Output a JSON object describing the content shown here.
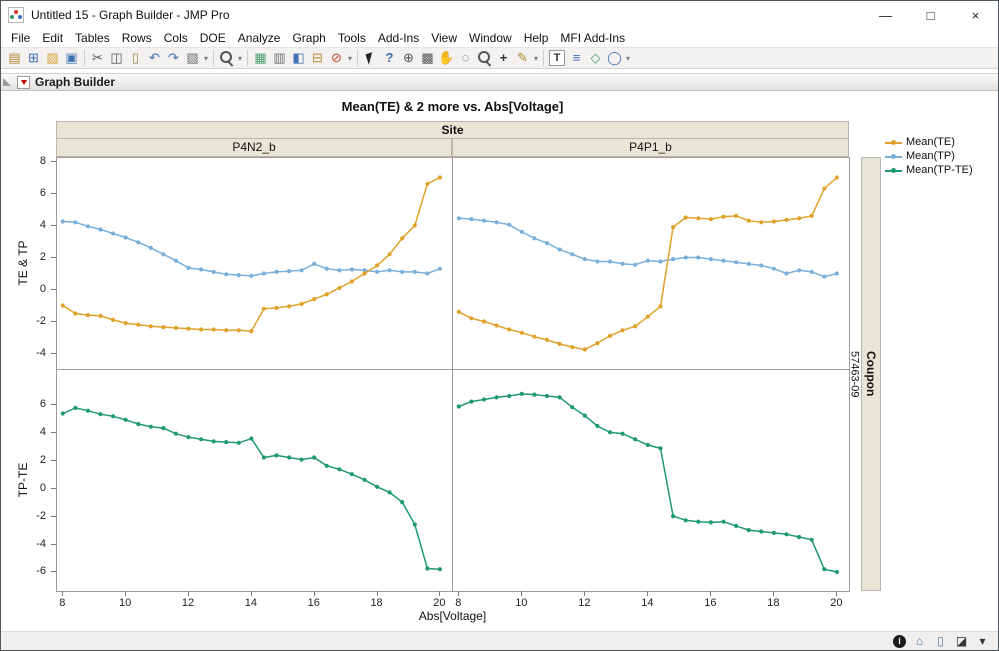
{
  "window": {
    "title": "Untitled 15 - Graph Builder - JMP Pro",
    "controls": {
      "minimize": "—",
      "maximize": "□",
      "close": "×"
    }
  },
  "menus": [
    "File",
    "Edit",
    "Tables",
    "Rows",
    "Cols",
    "DOE",
    "Analyze",
    "Graph",
    "Tools",
    "Add-Ins",
    "View",
    "Window",
    "Help",
    "MFI Add-Ins"
  ],
  "toolbar": {
    "items": [
      {
        "name": "new-journal-icon",
        "glyph": "▤",
        "color": "#b5892f"
      },
      {
        "name": "new-data-table-icon",
        "glyph": "⊞",
        "color": "#3f6fb5"
      },
      {
        "name": "open-icon",
        "glyph": "▨",
        "color": "#d9a23a"
      },
      {
        "name": "save-icon",
        "glyph": "▣",
        "color": "#3f6fb5"
      },
      {
        "sep": true
      },
      {
        "name": "cut-icon",
        "glyph": "✂",
        "color": "#555555"
      },
      {
        "name": "copy-icon",
        "glyph": "◫",
        "color": "#555555"
      },
      {
        "name": "paste-icon",
        "glyph": "▯",
        "color": "#a8824f"
      },
      {
        "name": "undo-icon",
        "glyph": "↶",
        "color": "#3f6fb5"
      },
      {
        "name": "redo-icon",
        "glyph": "↷",
        "color": "#3f6fb5"
      },
      {
        "name": "script-icon",
        "glyph": "▧",
        "color": "#6f6f6f",
        "dd": true
      },
      {
        "sep": true
      },
      {
        "name": "search-icon",
        "shape": "magnifier",
        "color": "#555555",
        "dd": true
      },
      {
        "sep": true
      },
      {
        "name": "data-table-icon",
        "glyph": "▦",
        "color": "#4a9e6b"
      },
      {
        "name": "summary-icon",
        "glyph": "▥",
        "color": "#6f6f6f"
      },
      {
        "name": "journal-page-icon",
        "glyph": "◧",
        "color": "#3f6fb5"
      },
      {
        "name": "database-icon",
        "glyph": "⊟",
        "color": "#b5892f"
      },
      {
        "name": "exclude-icon",
        "glyph": "⊘",
        "color": "#c2452d",
        "dd": true
      },
      {
        "sep": true
      },
      {
        "name": "selection-arrow-icon",
        "shape": "cursor",
        "color": "#333333"
      },
      {
        "name": "help-tool-icon",
        "glyph": "?",
        "color": "#3f6fb5",
        "bold": true
      },
      {
        "name": "crosshair-tool-icon",
        "glyph": "⊕",
        "color": "#555555"
      },
      {
        "name": "brush-tool-icon",
        "glyph": "▩",
        "color": "#555555"
      },
      {
        "name": "hand-tool-icon",
        "glyph": "✋",
        "color": "#c89557"
      },
      {
        "name": "lasso-tool-icon",
        "glyph": "◌",
        "color": "#555555"
      },
      {
        "name": "zoom-tool-icon",
        "shape": "magnifier",
        "color": "#555555"
      },
      {
        "name": "plus-tool-icon",
        "glyph": "+",
        "color": "#333333",
        "bold": true
      },
      {
        "name": "pencil-tool-icon",
        "glyph": "✎",
        "color": "#b5892f",
        "dd": true
      },
      {
        "sep": true
      },
      {
        "name": "text-annotate-icon",
        "glyph": "T",
        "color": "#333333",
        "boxed": true
      },
      {
        "name": "lines-annotate-icon",
        "glyph": "≡",
        "color": "#3f6fb5"
      },
      {
        "name": "polygon-annotate-icon",
        "glyph": "◇",
        "color": "#4a9e6b"
      },
      {
        "name": "oval-annotate-icon",
        "glyph": "◯",
        "color": "#3f6fb5",
        "dd": true
      }
    ]
  },
  "outline": {
    "title": "Graph Builder"
  },
  "chart_data": {
    "type": "line",
    "title": "Mean(TE) & 2 more vs. Abs[Voltage]",
    "xlabel": "Abs[Voltage]",
    "facet": {
      "col_header": "Site",
      "cols": [
        "P4N2_b",
        "P4P1_b"
      ],
      "row_band_label": "Coupon",
      "row_value": "57463-09"
    },
    "xlim": [
      7.8,
      20.4
    ],
    "x_ticks": [
      8,
      10,
      12,
      14,
      16,
      18,
      20
    ],
    "rows": [
      {
        "ylabel": "TE & TP",
        "ylim": [
          -5.0,
          8.25
        ],
        "yticks": [
          8,
          6,
          4,
          2,
          0,
          -2,
          -4
        ]
      },
      {
        "ylabel": "TP-TE",
        "ylim": [
          -7.4,
          8.5
        ],
        "yticks": [
          6,
          4,
          2,
          0,
          -2,
          -4,
          -6
        ]
      }
    ],
    "legend": [
      {
        "name": "Mean(TE)",
        "color": "#DFA22B"
      },
      {
        "name": "Mean(TP)",
        "color": "#79AFD9"
      },
      {
        "name": "Mean(TP-TE)",
        "color": "#1F9A6C"
      }
    ],
    "x": [
      8,
      8.4,
      8.8,
      9.2,
      9.6,
      10,
      10.4,
      10.8,
      11.2,
      11.6,
      12,
      12.4,
      12.8,
      13.2,
      13.6,
      14,
      14.4,
      14.8,
      15.2,
      15.6,
      16,
      16.4,
      16.8,
      17.2,
      17.6,
      18,
      18.4,
      18.8,
      19.2,
      19.6,
      20
    ],
    "panels": [
      {
        "col": 0,
        "row": 0,
        "series": [
          {
            "name": "Mean(TP)",
            "color": "#79AFD9",
            "y": [
              4.25,
              4.2,
              3.95,
              3.75,
              3.5,
              3.25,
              2.95,
              2.6,
              2.2,
              1.8,
              1.35,
              1.25,
              1.1,
              0.95,
              0.9,
              0.85,
              1.0,
              1.1,
              1.15,
              1.2,
              1.6,
              1.3,
              1.2,
              1.25,
              1.2,
              1.1,
              1.2,
              1.1,
              1.1,
              1.0,
              1.3
            ]
          },
          {
            "name": "Mean(TE)",
            "color": "#DFA22B",
            "y": [
              -1.0,
              -1.5,
              -1.6,
              -1.65,
              -1.9,
              -2.1,
              -2.2,
              -2.3,
              -2.35,
              -2.4,
              -2.45,
              -2.5,
              -2.5,
              -2.55,
              -2.55,
              -2.6,
              -1.2,
              -1.15,
              -1.05,
              -0.9,
              -0.6,
              -0.3,
              0.1,
              0.5,
              1.0,
              1.5,
              2.2,
              3.2,
              4.0,
              6.6,
              7.0
            ]
          }
        ]
      },
      {
        "col": 1,
        "row": 0,
        "series": [
          {
            "name": "Mean(TP)",
            "color": "#79AFD9",
            "y": [
              4.45,
              4.4,
              4.3,
              4.2,
              4.05,
              3.6,
              3.2,
              2.9,
              2.5,
              2.2,
              1.9,
              1.75,
              1.75,
              1.6,
              1.55,
              1.8,
              1.75,
              1.9,
              2.0,
              2.0,
              1.9,
              1.8,
              1.7,
              1.6,
              1.5,
              1.3,
              1.0,
              1.2,
              1.1,
              0.8,
              1.0
            ]
          },
          {
            "name": "Mean(TE)",
            "color": "#DFA22B",
            "y": [
              -1.4,
              -1.8,
              -2.0,
              -2.25,
              -2.5,
              -2.7,
              -2.95,
              -3.15,
              -3.4,
              -3.6,
              -3.75,
              -3.35,
              -2.9,
              -2.55,
              -2.3,
              -1.7,
              -1.05,
              3.9,
              4.5,
              4.45,
              4.4,
              4.55,
              4.6,
              4.3,
              4.2,
              4.25,
              4.35,
              4.45,
              4.6,
              6.3,
              7.0
            ]
          }
        ]
      },
      {
        "col": 0,
        "row": 1,
        "series": [
          {
            "name": "Mean(TP-TE)",
            "color": "#1F9A6C",
            "y": [
              5.35,
              5.75,
              5.55,
              5.3,
              5.15,
              4.9,
              4.6,
              4.4,
              4.3,
              3.9,
              3.65,
              3.5,
              3.35,
              3.3,
              3.25,
              3.55,
              2.2,
              2.35,
              2.2,
              2.05,
              2.2,
              1.6,
              1.35,
              1.0,
              0.6,
              0.1,
              -0.3,
              -1.0,
              -2.6,
              -5.75,
              -5.8
            ]
          }
        ]
      },
      {
        "col": 1,
        "row": 1,
        "series": [
          {
            "name": "Mean(TP-TE)",
            "color": "#1F9A6C",
            "y": [
              5.85,
              6.2,
              6.35,
              6.5,
              6.6,
              6.75,
              6.7,
              6.6,
              6.5,
              5.8,
              5.2,
              4.45,
              4.0,
              3.9,
              3.5,
              3.1,
              2.85,
              -2.0,
              -2.3,
              -2.4,
              -2.45,
              -2.4,
              -2.7,
              -3.0,
              -3.1,
              -3.2,
              -3.3,
              -3.5,
              -3.7,
              -5.8,
              -6.0
            ]
          }
        ]
      }
    ]
  },
  "statusbar": {
    "items": [
      {
        "name": "info-status-icon",
        "glyph": "i",
        "circle": true,
        "color": "#ffffff",
        "bg": "#1b1b1b"
      },
      {
        "name": "home-window-icon",
        "glyph": "⌂",
        "color": "#3f6fb5"
      },
      {
        "name": "clipboard-status-icon",
        "glyph": "▯",
        "color": "#66829e"
      },
      {
        "name": "display-box-icon",
        "glyph": "◪",
        "color": "#333333"
      },
      {
        "name": "status-dropdown-icon",
        "glyph": "▾",
        "color": "#333333"
      }
    ]
  }
}
